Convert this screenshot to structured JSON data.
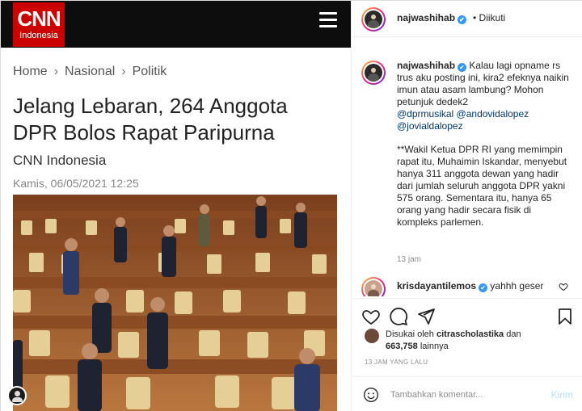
{
  "article": {
    "brand": "CNN",
    "brand_sub": "Indonesia",
    "breadcrumbs": [
      "Home",
      "Nasional",
      "Politik"
    ],
    "breadcrumb_sep": "›",
    "headline": "Jelang Lebaran, 264 Anggota DPR Bolos Rapat Paripurna",
    "source": "CNN Indonesia",
    "date": "Kamis, 06/05/2021 12:25",
    "colors": {
      "brand_red": "#cc0000",
      "topbar": "#0d0d0d"
    }
  },
  "post": {
    "header": {
      "username": "najwashihab",
      "verified": "✔",
      "follow_status": "• Diikuti"
    },
    "caption": {
      "username": "najwashihab",
      "verified": "✔",
      "text1": "Kalau lagi opname rs trus aku posting ini, kira2 efeknya naikin imun atau asam lambung? Mohon petunjuk dedek2",
      "mentions": [
        "@dprmusikal",
        "@andovidalopez",
        "@jovialdalopez"
      ],
      "text2": "**Wakil Ketua DPR RI yang memimpin rapat itu, Muhaimin Iskandar, menyebut hanya 311 anggota dewan yang hadir dari jumlah seluruh anggota DPR yakni 575 orang. Sementara itu, hanya 65 orang yang hadir secara fisik di kompleks parlemen.",
      "time": "13 jam"
    },
    "comment": {
      "username": "krisdayantilemos",
      "verified": "✔",
      "text": "yahhh geser"
    },
    "likes": {
      "prefix": "Disukai oleh ",
      "user": "citraschola",
      "user_rest": "stika",
      "middle": " dan",
      "count": "663,758",
      "suffix": " lainnya"
    },
    "time_ago": "13 JAM YANG LALU",
    "add_comment": {
      "placeholder": "Tambahkan komentar...",
      "post_label": "Kirim"
    },
    "icons": [
      "heart-icon",
      "comment-icon",
      "share-icon",
      "bookmark-icon",
      "emoji-icon"
    ]
  }
}
